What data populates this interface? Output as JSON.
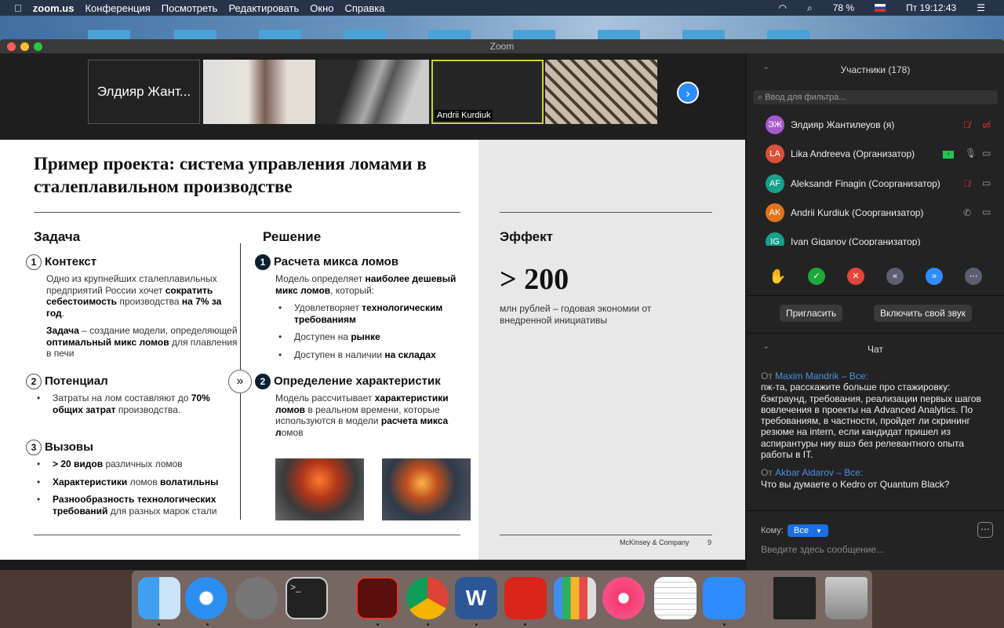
{
  "menubar": {
    "app": "zoom.us",
    "items": [
      "Конференция",
      "Посмотреть",
      "Редактировать",
      "Окно",
      "Справка"
    ],
    "battery": "78 %",
    "clock": "Пт 19:12:43"
  },
  "window": {
    "title": "Zoom"
  },
  "videos": {
    "tiles": [
      {
        "name": "Элдияр Жант..."
      },
      {
        "name": ""
      },
      {
        "name": ""
      },
      {
        "name": "Andrii Kurdiuk"
      },
      {
        "name": ""
      }
    ]
  },
  "slide": {
    "title": "Пример проекта: система управления ломами в сталеплавильном производстве",
    "col1": {
      "heading": "Задача",
      "s1": {
        "n": "1",
        "title": "Контекст",
        "p1a": "Одно из крупнейших сталеплавильных предприятий России хочет ",
        "p1b": "сократить себестоимость",
        "p1c": " производства ",
        "p1d": "на 7% за год",
        "p2a": "Задача",
        "p2b": " – создание модели, определяющей ",
        "p2c": "оптимальный микс ломов",
        "p2d": " для плавления в печи"
      },
      "s2": {
        "n": "2",
        "title": "Потенциал",
        "b1a": "Затраты на лом составляют до ",
        "b1b": "70% общих затрат",
        "b1c": " производства."
      },
      "s3": {
        "n": "3",
        "title": "Вызовы",
        "b1a": "> 20 видов",
        "b1b": " различных ломов",
        "b2a": "Характеристики",
        "b2b": " ломов ",
        "b2c": "волатильны",
        "b3a": "Разнообразность технологических требований",
        "b3b": " для разных марок стали"
      }
    },
    "col2": {
      "heading": "Решение",
      "s1": {
        "n": "1",
        "title": "Расчета микса ломов",
        "pa": "Модель определяет ",
        "pb": "наиболее дешевый микс ломов",
        "pc": ", который:",
        "b1a": "Удовлетворяет ",
        "b1b": "технологическим требованиям",
        "b2a": "Доступен на ",
        "b2b": "рынке",
        "b3a": "Доступен в наличии ",
        "b3b": "на складах"
      },
      "s2": {
        "n": "2",
        "title": "Определение характеристик",
        "pa": "Модель рассчитывает ",
        "pb": "характеристики ломов",
        "pc": " в реальном времени, которые используются в модели ",
        "pd": "расчета микса л",
        "pe": "омов"
      }
    },
    "col3": {
      "heading": "Эффект",
      "big": "> 200",
      "desc": "млн рублей – годовая экономии от внедренной инициативы"
    },
    "footer": {
      "company": "McKinsey & Company",
      "page": "9"
    }
  },
  "participants": {
    "title": "Участники (178)",
    "filter_placeholder": "Ввод для фильтра...",
    "list": [
      {
        "initials": "ЭЖ",
        "name": "Элдияр Жантилеуов (я)",
        "color": "#a659c9"
      },
      {
        "initials": "LA",
        "name": "Lika Andreeva (Организатор)",
        "color": "#d9503a"
      },
      {
        "initials": "AF",
        "name": "Aleksandr Finagin (Соорганизатор)",
        "color": "#17a08a"
      },
      {
        "initials": "AK",
        "name": "Andrii Kurdiuk (Соорганизатор)",
        "color": "#e0741c"
      },
      {
        "initials": "IG",
        "name": "Ivan Giganov (Соорганизатор)",
        "color": "#17a08a"
      }
    ],
    "invite": "Пригласить",
    "unmute": "Включить свой звук"
  },
  "chat": {
    "title": "Чат",
    "messages": [
      {
        "from_prefix": "От ",
        "from": "Maxim Mandrik – Все:",
        "text": "пж-та, расскажите больше про стажировку: бэкграунд, требования, реализации первых шагов вовлечения в проекты на Advanced Analytics. По требованиям, в частности, пройдет ли скрининг резюме на intern, если кандидат пришел из аспирантуры  ниу вшэ без релевантного опыта работы в IT."
      },
      {
        "from_prefix": "От ",
        "from": "Akbar Aidarov – Все:",
        "text": "Что вы думаете о Kedro от Quantum Black?"
      }
    ],
    "to_label": "Кому:",
    "to_value": "Все",
    "placeholder": "Введите здесь сообщение..."
  }
}
